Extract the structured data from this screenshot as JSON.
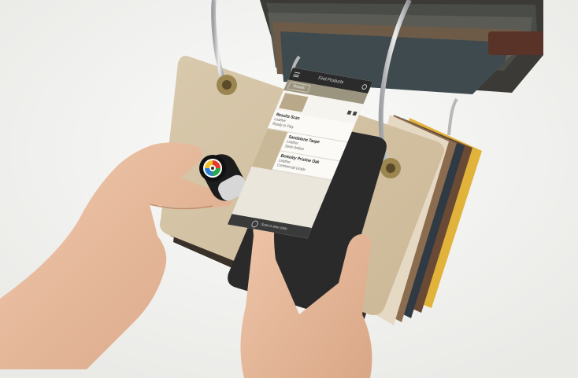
{
  "app": {
    "title": "Find Products",
    "filter_label": "Results"
  },
  "results": [
    {
      "name": "Results Scan",
      "line1": "Leather",
      "line2": "Ready to Play"
    },
    {
      "name": "Sandstone Taupe",
      "line1": "Leather",
      "line2": "Semi-Aniline"
    },
    {
      "name": "Berkeley Pristine Oak",
      "line1": "Leather",
      "line2": "Commercial Grade"
    }
  ],
  "bottom": {
    "label": "Scan a new color"
  },
  "colors": {
    "leather_tan": "#d7c7ab",
    "phone_body": "#2a2a2a",
    "sensor_black": "#1c1c1c",
    "binder_ring": "#cfd0d2"
  },
  "icons": [
    "menu-icon",
    "search-icon",
    "scan-icon",
    "color-logo-icon"
  ]
}
